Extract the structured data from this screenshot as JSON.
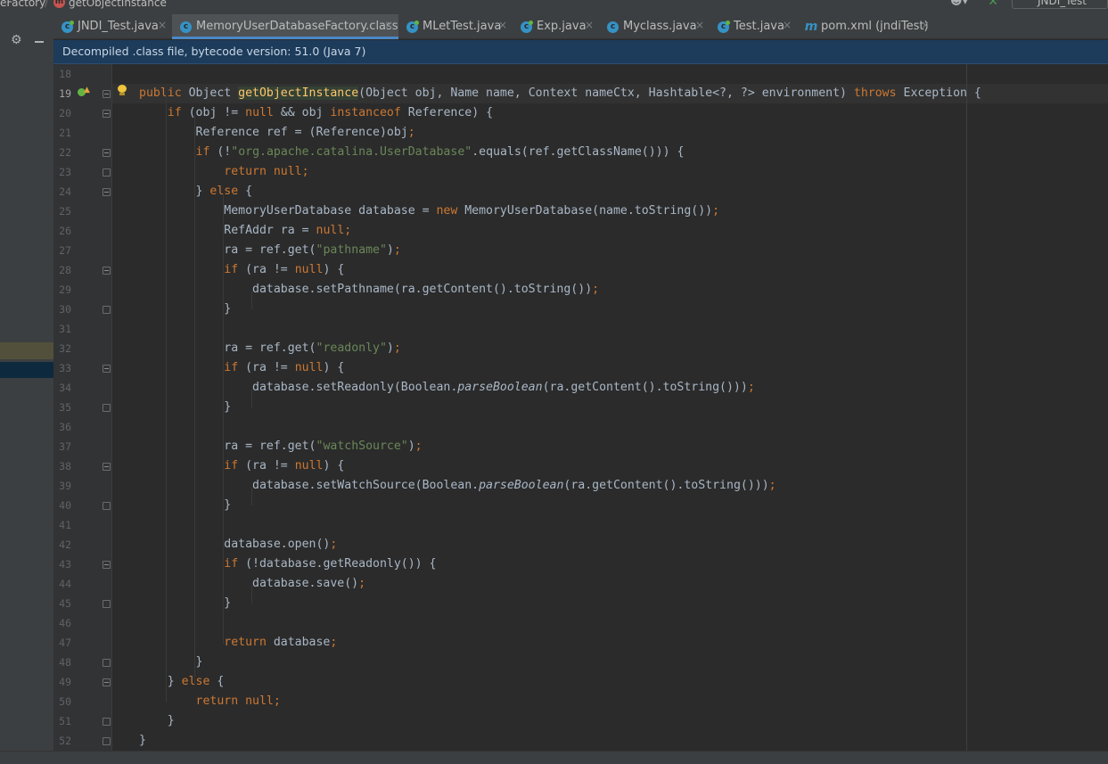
{
  "breadcrumb": {
    "class_name": "eFactory",
    "separator": "/",
    "method_icon_letter": "m",
    "method_name": "getObjectInstance",
    "user_icon": "user-icon",
    "build_icon": "hammer-icon",
    "project_name": "JNDI_Test"
  },
  "toolbar": {
    "settings_icon": "gear-icon",
    "hide_icon": "minus-icon"
  },
  "tabs": [
    {
      "label": "JNDI_Test.java",
      "icon": "java-class-icon",
      "close": "×",
      "active": false
    },
    {
      "label": "MemoryUserDatabaseFactory.class",
      "icon": "class-icon",
      "close": "×",
      "active": true
    },
    {
      "label": "MLetTest.java",
      "icon": "java-class-icon",
      "close": "×",
      "active": false
    },
    {
      "label": "Exp.java",
      "icon": "java-class-icon",
      "close": "×",
      "active": false
    },
    {
      "label": "Myclass.java",
      "icon": "class-icon",
      "close": "×",
      "active": false
    },
    {
      "label": "Test.java",
      "icon": "java-class-icon",
      "close": "×",
      "active": false
    },
    {
      "label": "pom.xml (jndiTest)",
      "icon": "maven-icon",
      "close": "×",
      "active": false
    }
  ],
  "maven_icon_letter": "m",
  "class_icon_letter": "c",
  "banner": {
    "text": "Decompiled .class file, bytecode version: 51.0 (Java 7)"
  },
  "editor": {
    "current_line": 19,
    "colors": {
      "keyword": "#cc7832",
      "string": "#6a8759",
      "method_decl": "#ffc66d",
      "default": "#a9b7c6",
      "background": "#2b2b2b"
    },
    "lines": [
      {
        "n": "18",
        "code": []
      },
      {
        "n": "19",
        "code": [
          [
            "kw",
            "public "
          ],
          [
            "",
            "Object "
          ],
          [
            "mdecl",
            "getObjectInstance"
          ],
          [
            "",
            "(Object obj, Name name, Context nameCtx, Hashtable<?, ?> environment) "
          ],
          [
            "kw",
            "throws "
          ],
          [
            "",
            "Exception {"
          ]
        ]
      },
      {
        "n": "20",
        "code": [
          [
            "",
            "    "
          ],
          [
            "kw",
            "if "
          ],
          [
            "",
            "(obj != "
          ],
          [
            "kw",
            "null "
          ],
          [
            "",
            "&& obj "
          ],
          [
            "kw",
            "instanceof "
          ],
          [
            "",
            "Reference) {"
          ]
        ]
      },
      {
        "n": "21",
        "code": [
          [
            "",
            "        Reference ref = (Reference)obj"
          ],
          [
            "kw",
            ";"
          ]
        ]
      },
      {
        "n": "22",
        "code": [
          [
            "",
            "        "
          ],
          [
            "kw",
            "if "
          ],
          [
            "",
            "(!"
          ],
          [
            "str",
            "\"org.apache.catalina.UserDatabase\""
          ],
          [
            "",
            ".equals(ref.getClassName())) {"
          ]
        ]
      },
      {
        "n": "23",
        "code": [
          [
            "",
            "            "
          ],
          [
            "kw",
            "return null;"
          ]
        ]
      },
      {
        "n": "24",
        "code": [
          [
            "",
            "        } "
          ],
          [
            "kw",
            "else "
          ],
          [
            "",
            "{"
          ]
        ]
      },
      {
        "n": "25",
        "code": [
          [
            "",
            "            MemoryUserDatabase database = "
          ],
          [
            "kw",
            "new "
          ],
          [
            "",
            "MemoryUserDatabase(name.toString())"
          ],
          [
            "kw",
            ";"
          ]
        ]
      },
      {
        "n": "26",
        "code": [
          [
            "",
            "            RefAddr ra = "
          ],
          [
            "kw",
            "null;"
          ]
        ]
      },
      {
        "n": "27",
        "code": [
          [
            "",
            "            ra = ref.get("
          ],
          [
            "str",
            "\"pathname\""
          ],
          [
            "",
            ")"
          ],
          [
            "kw",
            ";"
          ]
        ]
      },
      {
        "n": "28",
        "code": [
          [
            "",
            "            "
          ],
          [
            "kw",
            "if "
          ],
          [
            "",
            "(ra != "
          ],
          [
            "kw",
            "null"
          ],
          [
            "",
            ") {"
          ]
        ]
      },
      {
        "n": "29",
        "code": [
          [
            "",
            "                database.setPathname(ra.getContent().toString())"
          ],
          [
            "kw",
            ";"
          ]
        ]
      },
      {
        "n": "30",
        "code": [
          [
            "",
            "            }"
          ]
        ]
      },
      {
        "n": "31",
        "code": []
      },
      {
        "n": "32",
        "code": [
          [
            "",
            "            ra = ref.get("
          ],
          [
            "str",
            "\"readonly\""
          ],
          [
            "",
            ")"
          ],
          [
            "kw",
            ";"
          ]
        ]
      },
      {
        "n": "33",
        "code": [
          [
            "",
            "            "
          ],
          [
            "kw",
            "if "
          ],
          [
            "",
            "(ra != "
          ],
          [
            "kw",
            "null"
          ],
          [
            "",
            ") {"
          ]
        ]
      },
      {
        "n": "34",
        "code": [
          [
            "",
            "                database.setReadonly(Boolean."
          ],
          [
            "it",
            "parseBoolean"
          ],
          [
            "",
            "(ra.getContent().toString()))"
          ],
          [
            "kw",
            ";"
          ]
        ]
      },
      {
        "n": "35",
        "code": [
          [
            "",
            "            }"
          ]
        ]
      },
      {
        "n": "36",
        "code": []
      },
      {
        "n": "37",
        "code": [
          [
            "",
            "            ra = ref.get("
          ],
          [
            "str",
            "\"watchSource\""
          ],
          [
            "",
            ")"
          ],
          [
            "kw",
            ";"
          ]
        ]
      },
      {
        "n": "38",
        "code": [
          [
            "",
            "            "
          ],
          [
            "kw",
            "if "
          ],
          [
            "",
            "(ra != "
          ],
          [
            "kw",
            "null"
          ],
          [
            "",
            ") {"
          ]
        ]
      },
      {
        "n": "39",
        "code": [
          [
            "",
            "                database.setWatchSource(Boolean."
          ],
          [
            "it",
            "parseBoolean"
          ],
          [
            "",
            "(ra.getContent().toString()))"
          ],
          [
            "kw",
            ";"
          ]
        ]
      },
      {
        "n": "40",
        "code": [
          [
            "",
            "            }"
          ]
        ]
      },
      {
        "n": "41",
        "code": []
      },
      {
        "n": "42",
        "code": [
          [
            "",
            "            database.open()"
          ],
          [
            "kw",
            ";"
          ]
        ]
      },
      {
        "n": "43",
        "code": [
          [
            "",
            "            "
          ],
          [
            "kw",
            "if "
          ],
          [
            "",
            "(!database.getReadonly()) {"
          ]
        ]
      },
      {
        "n": "44",
        "code": [
          [
            "",
            "                database.save()"
          ],
          [
            "kw",
            ";"
          ]
        ]
      },
      {
        "n": "45",
        "code": [
          [
            "",
            "            }"
          ]
        ]
      },
      {
        "n": "46",
        "code": []
      },
      {
        "n": "47",
        "code": [
          [
            "",
            "            "
          ],
          [
            "kw",
            "return "
          ],
          [
            "",
            "database"
          ],
          [
            "kw",
            ";"
          ]
        ]
      },
      {
        "n": "48",
        "code": [
          [
            "",
            "        }"
          ]
        ]
      },
      {
        "n": "49",
        "code": [
          [
            "",
            "    } "
          ],
          [
            "kw",
            "else "
          ],
          [
            "",
            "{"
          ]
        ]
      },
      {
        "n": "50",
        "code": [
          [
            "",
            "        "
          ],
          [
            "kw",
            "return null;"
          ]
        ]
      },
      {
        "n": "51",
        "code": [
          [
            "",
            "    }"
          ]
        ]
      },
      {
        "n": "52",
        "code": [
          [
            "",
            "}"
          ]
        ]
      }
    ]
  }
}
